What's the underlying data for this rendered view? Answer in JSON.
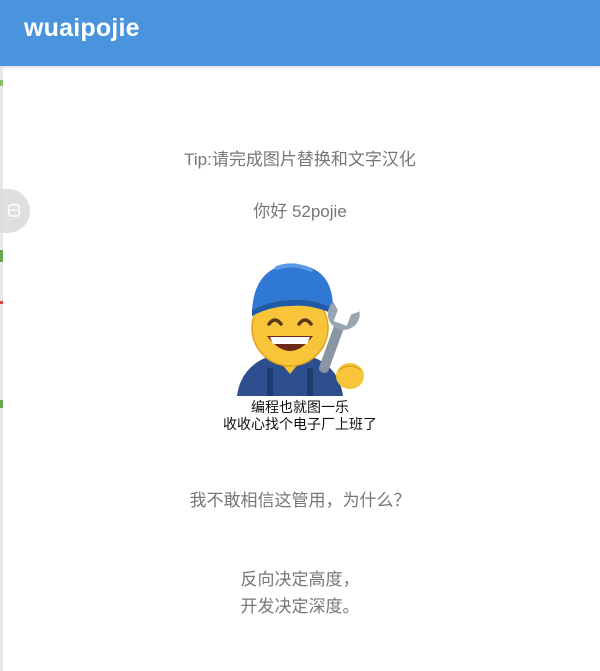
{
  "appbar": {
    "title": "wuaipojie",
    "color": "#4a93dd"
  },
  "main": {
    "tip": "Tip:请完成图片替换和文字汉化",
    "greeting": "你好 52pojie",
    "meme": {
      "icon": "mechanic-emoji-with-wrench",
      "caption_line1": "编程也就图一乐",
      "caption_line2": "收收心找个电子厂上班了"
    },
    "question": "我不敢相信这管用，为什么？",
    "quote_line1": "反向决定高度，",
    "quote_line2": "开发决定深度。"
  },
  "overlay": {
    "float_handle_icon": "floating-ball-icon"
  }
}
